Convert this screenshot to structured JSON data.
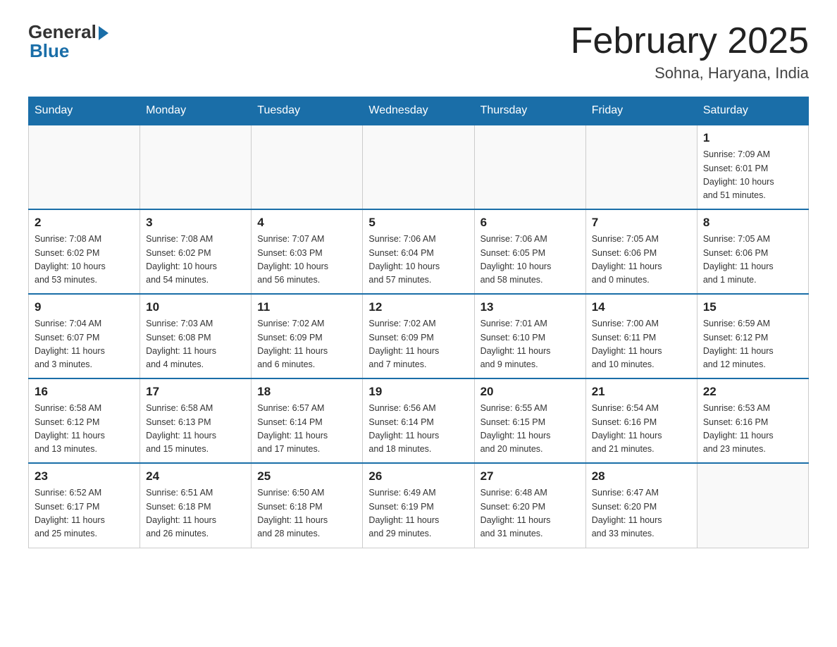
{
  "logo": {
    "general": "General",
    "blue": "Blue"
  },
  "title": "February 2025",
  "location": "Sohna, Haryana, India",
  "days_of_week": [
    "Sunday",
    "Monday",
    "Tuesday",
    "Wednesday",
    "Thursday",
    "Friday",
    "Saturday"
  ],
  "weeks": [
    [
      {
        "day": "",
        "info": ""
      },
      {
        "day": "",
        "info": ""
      },
      {
        "day": "",
        "info": ""
      },
      {
        "day": "",
        "info": ""
      },
      {
        "day": "",
        "info": ""
      },
      {
        "day": "",
        "info": ""
      },
      {
        "day": "1",
        "info": "Sunrise: 7:09 AM\nSunset: 6:01 PM\nDaylight: 10 hours\nand 51 minutes."
      }
    ],
    [
      {
        "day": "2",
        "info": "Sunrise: 7:08 AM\nSunset: 6:02 PM\nDaylight: 10 hours\nand 53 minutes."
      },
      {
        "day": "3",
        "info": "Sunrise: 7:08 AM\nSunset: 6:02 PM\nDaylight: 10 hours\nand 54 minutes."
      },
      {
        "day": "4",
        "info": "Sunrise: 7:07 AM\nSunset: 6:03 PM\nDaylight: 10 hours\nand 56 minutes."
      },
      {
        "day": "5",
        "info": "Sunrise: 7:06 AM\nSunset: 6:04 PM\nDaylight: 10 hours\nand 57 minutes."
      },
      {
        "day": "6",
        "info": "Sunrise: 7:06 AM\nSunset: 6:05 PM\nDaylight: 10 hours\nand 58 minutes."
      },
      {
        "day": "7",
        "info": "Sunrise: 7:05 AM\nSunset: 6:06 PM\nDaylight: 11 hours\nand 0 minutes."
      },
      {
        "day": "8",
        "info": "Sunrise: 7:05 AM\nSunset: 6:06 PM\nDaylight: 11 hours\nand 1 minute."
      }
    ],
    [
      {
        "day": "9",
        "info": "Sunrise: 7:04 AM\nSunset: 6:07 PM\nDaylight: 11 hours\nand 3 minutes."
      },
      {
        "day": "10",
        "info": "Sunrise: 7:03 AM\nSunset: 6:08 PM\nDaylight: 11 hours\nand 4 minutes."
      },
      {
        "day": "11",
        "info": "Sunrise: 7:02 AM\nSunset: 6:09 PM\nDaylight: 11 hours\nand 6 minutes."
      },
      {
        "day": "12",
        "info": "Sunrise: 7:02 AM\nSunset: 6:09 PM\nDaylight: 11 hours\nand 7 minutes."
      },
      {
        "day": "13",
        "info": "Sunrise: 7:01 AM\nSunset: 6:10 PM\nDaylight: 11 hours\nand 9 minutes."
      },
      {
        "day": "14",
        "info": "Sunrise: 7:00 AM\nSunset: 6:11 PM\nDaylight: 11 hours\nand 10 minutes."
      },
      {
        "day": "15",
        "info": "Sunrise: 6:59 AM\nSunset: 6:12 PM\nDaylight: 11 hours\nand 12 minutes."
      }
    ],
    [
      {
        "day": "16",
        "info": "Sunrise: 6:58 AM\nSunset: 6:12 PM\nDaylight: 11 hours\nand 13 minutes."
      },
      {
        "day": "17",
        "info": "Sunrise: 6:58 AM\nSunset: 6:13 PM\nDaylight: 11 hours\nand 15 minutes."
      },
      {
        "day": "18",
        "info": "Sunrise: 6:57 AM\nSunset: 6:14 PM\nDaylight: 11 hours\nand 17 minutes."
      },
      {
        "day": "19",
        "info": "Sunrise: 6:56 AM\nSunset: 6:14 PM\nDaylight: 11 hours\nand 18 minutes."
      },
      {
        "day": "20",
        "info": "Sunrise: 6:55 AM\nSunset: 6:15 PM\nDaylight: 11 hours\nand 20 minutes."
      },
      {
        "day": "21",
        "info": "Sunrise: 6:54 AM\nSunset: 6:16 PM\nDaylight: 11 hours\nand 21 minutes."
      },
      {
        "day": "22",
        "info": "Sunrise: 6:53 AM\nSunset: 6:16 PM\nDaylight: 11 hours\nand 23 minutes."
      }
    ],
    [
      {
        "day": "23",
        "info": "Sunrise: 6:52 AM\nSunset: 6:17 PM\nDaylight: 11 hours\nand 25 minutes."
      },
      {
        "day": "24",
        "info": "Sunrise: 6:51 AM\nSunset: 6:18 PM\nDaylight: 11 hours\nand 26 minutes."
      },
      {
        "day": "25",
        "info": "Sunrise: 6:50 AM\nSunset: 6:18 PM\nDaylight: 11 hours\nand 28 minutes."
      },
      {
        "day": "26",
        "info": "Sunrise: 6:49 AM\nSunset: 6:19 PM\nDaylight: 11 hours\nand 29 minutes."
      },
      {
        "day": "27",
        "info": "Sunrise: 6:48 AM\nSunset: 6:20 PM\nDaylight: 11 hours\nand 31 minutes."
      },
      {
        "day": "28",
        "info": "Sunrise: 6:47 AM\nSunset: 6:20 PM\nDaylight: 11 hours\nand 33 minutes."
      },
      {
        "day": "",
        "info": ""
      }
    ]
  ]
}
